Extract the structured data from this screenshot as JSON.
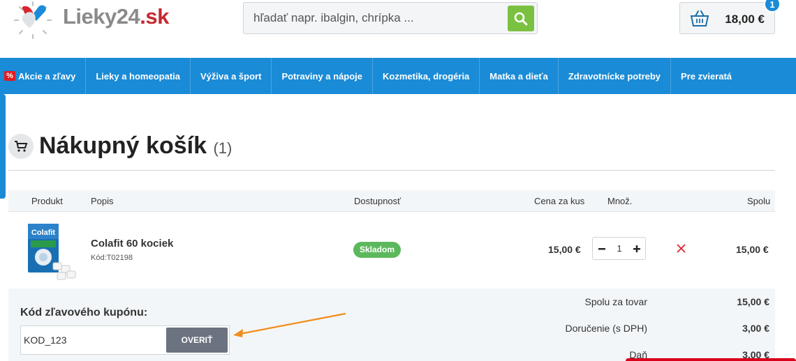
{
  "header": {
    "logo_main": "Lieky24",
    "logo_tld": ".sk",
    "search_placeholder": "hľadať napr. ibalgin, chrípka ...",
    "cart_total": "18,00 €",
    "cart_count": "1"
  },
  "nav": {
    "items": [
      {
        "label": "Akcie a zľavy",
        "badge": "%"
      },
      {
        "label": "Lieky a homeopatia"
      },
      {
        "label": "Výživa a šport"
      },
      {
        "label": "Potraviny a nápoje"
      },
      {
        "label": "Kozmetika, drogéria"
      },
      {
        "label": "Matka a dieťa"
      },
      {
        "label": "Zdravotnícke potreby"
      },
      {
        "label": "Pre zvieratá"
      }
    ]
  },
  "page": {
    "title": "Nákupný košík",
    "count": "(1)"
  },
  "table": {
    "headers": {
      "product": "Produkt",
      "description": "Popis",
      "availability": "Dostupnosť",
      "unit_price": "Cena za kus",
      "quantity": "Množ.",
      "total": "Spolu"
    },
    "rows": [
      {
        "name": "Colafit 60 kociek",
        "code": "Kód:T02198",
        "availability": "Skladom",
        "unit_price": "15,00 €",
        "quantity": "1",
        "total": "15,00 €",
        "image_text": "Colafit"
      }
    ]
  },
  "coupon": {
    "label": "Kód zľavového kupónu:",
    "value": "KOD_123",
    "button": "OVERIŤ"
  },
  "summary": {
    "items": [
      {
        "label": "Spolu za tovar",
        "value": "15,00 €"
      },
      {
        "label": "Doručenie (s DPH)",
        "value": "3,00 €"
      },
      {
        "label": "Daň",
        "value": "3,00 €"
      }
    ]
  },
  "colors": {
    "primary_blue": "#1a8bd6",
    "search_green": "#7ac142",
    "stock_green": "#5cb85c",
    "remove_red": "#d9262e",
    "arrow_orange": "#f28c1c"
  }
}
